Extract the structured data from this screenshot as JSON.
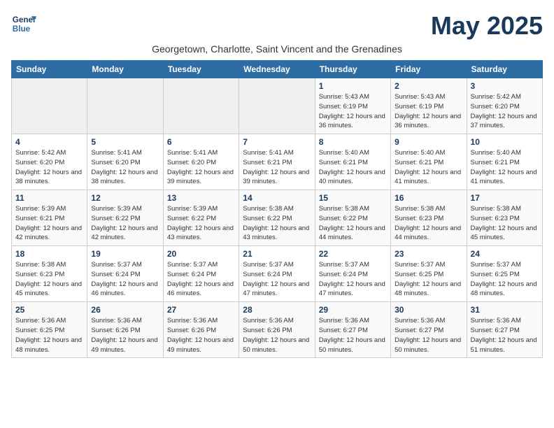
{
  "header": {
    "logo_line1": "General",
    "logo_line2": "Blue",
    "month": "May 2025",
    "subtitle": "Georgetown, Charlotte, Saint Vincent and the Grenadines"
  },
  "days_of_week": [
    "Sunday",
    "Monday",
    "Tuesday",
    "Wednesday",
    "Thursday",
    "Friday",
    "Saturday"
  ],
  "weeks": [
    [
      {
        "day": "",
        "info": ""
      },
      {
        "day": "",
        "info": ""
      },
      {
        "day": "",
        "info": ""
      },
      {
        "day": "",
        "info": ""
      },
      {
        "day": "1",
        "info": "Sunrise: 5:43 AM\nSunset: 6:19 PM\nDaylight: 12 hours\nand 36 minutes."
      },
      {
        "day": "2",
        "info": "Sunrise: 5:43 AM\nSunset: 6:19 PM\nDaylight: 12 hours\nand 36 minutes."
      },
      {
        "day": "3",
        "info": "Sunrise: 5:42 AM\nSunset: 6:20 PM\nDaylight: 12 hours\nand 37 minutes."
      }
    ],
    [
      {
        "day": "4",
        "info": "Sunrise: 5:42 AM\nSunset: 6:20 PM\nDaylight: 12 hours\nand 38 minutes."
      },
      {
        "day": "5",
        "info": "Sunrise: 5:41 AM\nSunset: 6:20 PM\nDaylight: 12 hours\nand 38 minutes."
      },
      {
        "day": "6",
        "info": "Sunrise: 5:41 AM\nSunset: 6:20 PM\nDaylight: 12 hours\nand 39 minutes."
      },
      {
        "day": "7",
        "info": "Sunrise: 5:41 AM\nSunset: 6:21 PM\nDaylight: 12 hours\nand 39 minutes."
      },
      {
        "day": "8",
        "info": "Sunrise: 5:40 AM\nSunset: 6:21 PM\nDaylight: 12 hours\nand 40 minutes."
      },
      {
        "day": "9",
        "info": "Sunrise: 5:40 AM\nSunset: 6:21 PM\nDaylight: 12 hours\nand 41 minutes."
      },
      {
        "day": "10",
        "info": "Sunrise: 5:40 AM\nSunset: 6:21 PM\nDaylight: 12 hours\nand 41 minutes."
      }
    ],
    [
      {
        "day": "11",
        "info": "Sunrise: 5:39 AM\nSunset: 6:21 PM\nDaylight: 12 hours\nand 42 minutes."
      },
      {
        "day": "12",
        "info": "Sunrise: 5:39 AM\nSunset: 6:22 PM\nDaylight: 12 hours\nand 42 minutes."
      },
      {
        "day": "13",
        "info": "Sunrise: 5:39 AM\nSunset: 6:22 PM\nDaylight: 12 hours\nand 43 minutes."
      },
      {
        "day": "14",
        "info": "Sunrise: 5:38 AM\nSunset: 6:22 PM\nDaylight: 12 hours\nand 43 minutes."
      },
      {
        "day": "15",
        "info": "Sunrise: 5:38 AM\nSunset: 6:22 PM\nDaylight: 12 hours\nand 44 minutes."
      },
      {
        "day": "16",
        "info": "Sunrise: 5:38 AM\nSunset: 6:23 PM\nDaylight: 12 hours\nand 44 minutes."
      },
      {
        "day": "17",
        "info": "Sunrise: 5:38 AM\nSunset: 6:23 PM\nDaylight: 12 hours\nand 45 minutes."
      }
    ],
    [
      {
        "day": "18",
        "info": "Sunrise: 5:38 AM\nSunset: 6:23 PM\nDaylight: 12 hours\nand 45 minutes."
      },
      {
        "day": "19",
        "info": "Sunrise: 5:37 AM\nSunset: 6:24 PM\nDaylight: 12 hours\nand 46 minutes."
      },
      {
        "day": "20",
        "info": "Sunrise: 5:37 AM\nSunset: 6:24 PM\nDaylight: 12 hours\nand 46 minutes."
      },
      {
        "day": "21",
        "info": "Sunrise: 5:37 AM\nSunset: 6:24 PM\nDaylight: 12 hours\nand 47 minutes."
      },
      {
        "day": "22",
        "info": "Sunrise: 5:37 AM\nSunset: 6:24 PM\nDaylight: 12 hours\nand 47 minutes."
      },
      {
        "day": "23",
        "info": "Sunrise: 5:37 AM\nSunset: 6:25 PM\nDaylight: 12 hours\nand 48 minutes."
      },
      {
        "day": "24",
        "info": "Sunrise: 5:37 AM\nSunset: 6:25 PM\nDaylight: 12 hours\nand 48 minutes."
      }
    ],
    [
      {
        "day": "25",
        "info": "Sunrise: 5:36 AM\nSunset: 6:25 PM\nDaylight: 12 hours\nand 48 minutes."
      },
      {
        "day": "26",
        "info": "Sunrise: 5:36 AM\nSunset: 6:26 PM\nDaylight: 12 hours\nand 49 minutes."
      },
      {
        "day": "27",
        "info": "Sunrise: 5:36 AM\nSunset: 6:26 PM\nDaylight: 12 hours\nand 49 minutes."
      },
      {
        "day": "28",
        "info": "Sunrise: 5:36 AM\nSunset: 6:26 PM\nDaylight: 12 hours\nand 50 minutes."
      },
      {
        "day": "29",
        "info": "Sunrise: 5:36 AM\nSunset: 6:27 PM\nDaylight: 12 hours\nand 50 minutes."
      },
      {
        "day": "30",
        "info": "Sunrise: 5:36 AM\nSunset: 6:27 PM\nDaylight: 12 hours\nand 50 minutes."
      },
      {
        "day": "31",
        "info": "Sunrise: 5:36 AM\nSunset: 6:27 PM\nDaylight: 12 hours\nand 51 minutes."
      }
    ]
  ]
}
